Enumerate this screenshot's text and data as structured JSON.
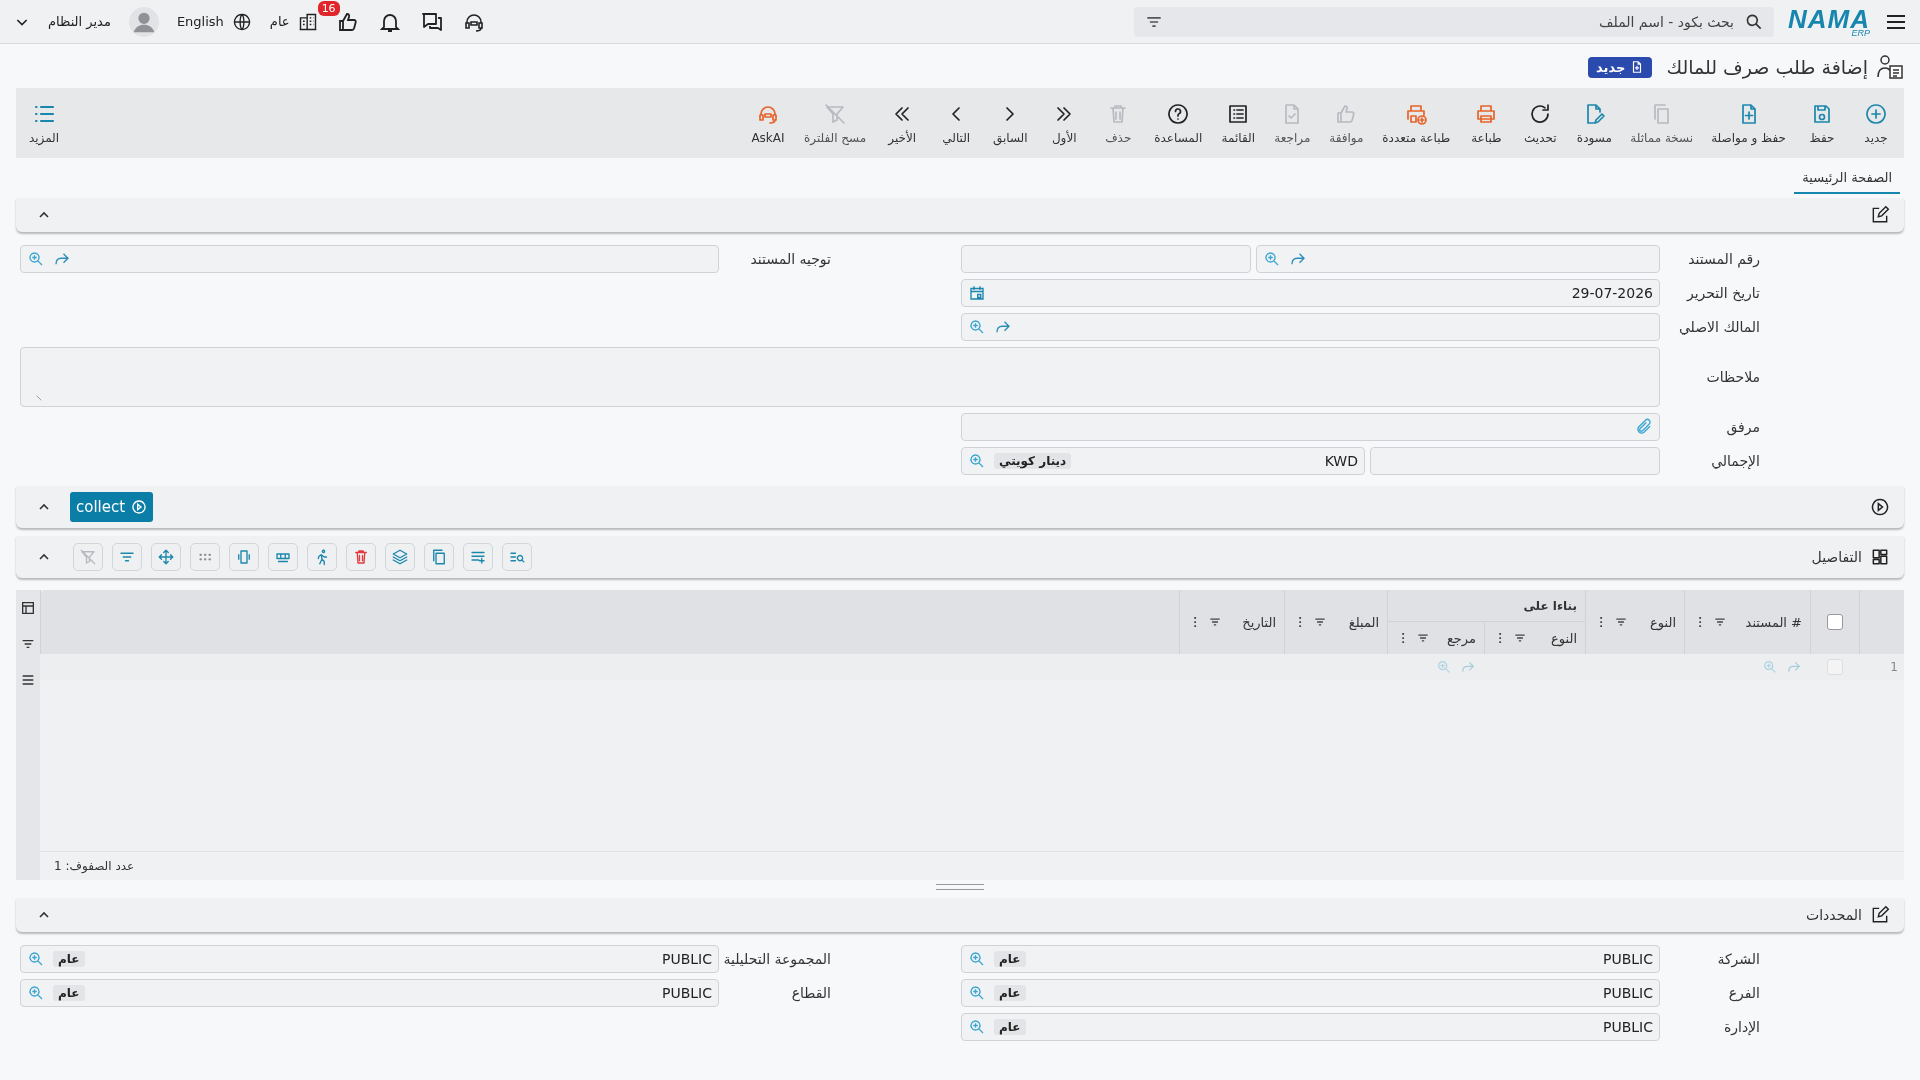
{
  "topbar": {
    "logo": "NAMA",
    "logo_sub": "ERP",
    "search_placeholder": "بحث بكود - اسم الملف",
    "approvals_badge": "16",
    "branch": "عام",
    "language": "English",
    "user": "مدير النظام"
  },
  "page": {
    "title": "إضافة طلب صرف للمالك",
    "status": "جديد"
  },
  "toolbar": [
    {
      "label": "جديد",
      "kind": "new",
      "disabled": false
    },
    {
      "label": "حفظ",
      "kind": "save",
      "disabled": false
    },
    {
      "label": "حفظ و مواصلة",
      "kind": "save-continue",
      "disabled": false
    },
    {
      "label": "نسخة مماثلة",
      "kind": "duplicate",
      "disabled": true
    },
    {
      "label": "مسودة",
      "kind": "draft",
      "disabled": false
    },
    {
      "label": "تحديث",
      "kind": "refresh",
      "disabled": false
    },
    {
      "label": "طباعة",
      "kind": "print",
      "disabled": false
    },
    {
      "label": "طباعة متعددة",
      "kind": "multi-print",
      "disabled": false
    },
    {
      "label": "موافقة",
      "kind": "approve",
      "disabled": true
    },
    {
      "label": "مراجعة",
      "kind": "review",
      "disabled": true
    },
    {
      "label": "القائمة",
      "kind": "list",
      "disabled": false
    },
    {
      "label": "المساعدة",
      "kind": "help",
      "disabled": false
    },
    {
      "label": "حذف",
      "kind": "delete",
      "disabled": true
    },
    {
      "label": "الأول",
      "kind": "first",
      "disabled": false
    },
    {
      "label": "السابق",
      "kind": "previous",
      "disabled": false
    },
    {
      "label": "التالي",
      "kind": "next",
      "disabled": false
    },
    {
      "label": "الأخير",
      "kind": "last",
      "disabled": false
    },
    {
      "label": "مسح الفلترة",
      "kind": "clear-filter",
      "disabled": true
    },
    {
      "label": "AskAI",
      "kind": "ask-ai",
      "disabled": false
    }
  ],
  "more": {
    "label": "المزيد"
  },
  "tabs": [
    {
      "label": "الصفحة الرئيسية",
      "selected": true
    }
  ],
  "main_form": {
    "right_fields": [
      {
        "label": "رقم المستند",
        "kind": "code"
      },
      {
        "label": "تاريخ التحرير",
        "kind": "date",
        "value": "29-07-2026"
      },
      {
        "label": "المالك الاصلي",
        "kind": "lookup"
      },
      {
        "label": "ملاحظات",
        "kind": "textarea"
      },
      {
        "label": "مرفق",
        "kind": "attachment"
      },
      {
        "label": "الإجمالي",
        "kind": "money",
        "currency_code": "KWD",
        "currency_name": "دينار كويتي"
      }
    ],
    "left_fields": [
      {
        "label": "توجيه المستند",
        "kind": "lookup"
      }
    ]
  },
  "actions": {
    "button": "collect"
  },
  "details": {
    "title": "التفاصيل",
    "tools": [
      {
        "kind": "list-search",
        "disabled": false
      },
      {
        "kind": "list-add",
        "disabled": false
      },
      {
        "kind": "copy",
        "disabled": false
      },
      {
        "kind": "layers",
        "disabled": false
      },
      {
        "kind": "delete",
        "disabled": false
      },
      {
        "kind": "runner",
        "disabled": false
      },
      {
        "kind": "row",
        "disabled": false
      },
      {
        "kind": "column",
        "disabled": false
      },
      {
        "kind": "dots",
        "disabled": false
      },
      {
        "kind": "move",
        "disabled": false
      },
      {
        "kind": "filter",
        "disabled": false
      },
      {
        "kind": "clear-filter",
        "disabled": true
      }
    ],
    "all_selected": false,
    "columns": [
      {
        "label": "# المستند",
        "kind": "lookup"
      },
      {
        "label": "النوع",
        "kind": "text"
      },
      {
        "label": "بناءا على",
        "children": [
          {
            "label": "النوع",
            "kind": "text"
          },
          {
            "label": "مرجع",
            "kind": "lookup"
          }
        ]
      },
      {
        "label": "المبلغ",
        "kind": "text"
      },
      {
        "label": "التاريخ",
        "kind": "text"
      }
    ],
    "rows": [
      {
        "number": "1",
        "selected": false
      }
    ],
    "row_count": "عدد الصفوف: 1"
  },
  "dimensions": {
    "title": "المحددات",
    "right_fields": [
      {
        "label": "الشركة",
        "value": "PUBLIC",
        "tag": "عام"
      },
      {
        "label": "الفرع",
        "value": "PUBLIC",
        "tag": "عام"
      },
      {
        "label": "الإدارة",
        "value": "PUBLIC",
        "tag": "عام"
      }
    ],
    "left_fields": [
      {
        "label": "المجموعة التحليلية",
        "value": "PUBLIC",
        "tag": "عام"
      },
      {
        "label": "القطاع",
        "value": "PUBLIC",
        "tag": "عام"
      }
    ]
  }
}
